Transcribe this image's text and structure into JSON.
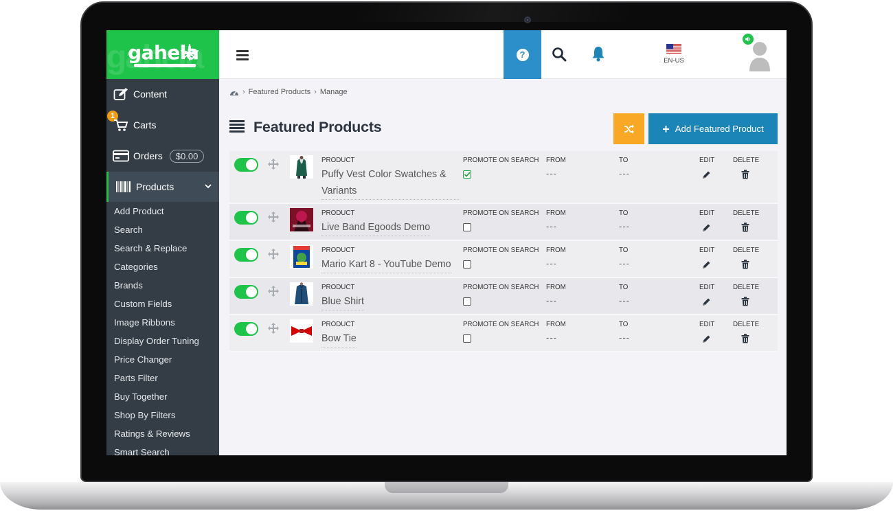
{
  "brand": {
    "logo_text": "gahela",
    "accent": "#1ec34a",
    "sidebar_bg": "#343d46",
    "primary": "#1b85b8",
    "warning": "#f9a825"
  },
  "sidebar": {
    "content_label": "Content",
    "carts_label": "Carts",
    "carts_badge": "1",
    "orders_label": "Orders",
    "orders_amount": "$0.00",
    "products_label": "Products",
    "submenu": [
      "Add Product",
      "Search",
      "Search & Replace",
      "Categories",
      "Brands",
      "Custom Fields",
      "Image Ribbons",
      "Display Order Tuning",
      "Price Changer",
      "Parts Filter",
      "Buy Together",
      "Shop By Filters",
      "Ratings & Reviews",
      "Smart Search"
    ]
  },
  "topbar": {
    "language": "EN-US",
    "help_glyph": "?"
  },
  "breadcrumb": {
    "current": "Featured Products",
    "action": "Manage",
    "separator": "›"
  },
  "page": {
    "title": "Featured Products",
    "add_button": "Add Featured Product",
    "add_plus": "+"
  },
  "columns": {
    "product": "PRODUCT",
    "promote": "PROMOTE ON SEARCH",
    "from": "FROM",
    "to": "TO",
    "edit": "EDIT",
    "delete": "DELETE"
  },
  "rows": [
    {
      "name": "Puffy Vest Color Swatches & Variants",
      "promote": true,
      "from": "---",
      "to": "---",
      "enabled": true
    },
    {
      "name": "Live Band Egoods Demo",
      "promote": false,
      "from": "---",
      "to": "---",
      "enabled": true
    },
    {
      "name": "Mario Kart 8 - YouTube Demo",
      "promote": false,
      "from": "---",
      "to": "---",
      "enabled": true
    },
    {
      "name": "Blue Shirt",
      "promote": false,
      "from": "---",
      "to": "---",
      "enabled": true
    },
    {
      "name": "Bow Tie",
      "promote": false,
      "from": "---",
      "to": "---",
      "enabled": true
    }
  ]
}
